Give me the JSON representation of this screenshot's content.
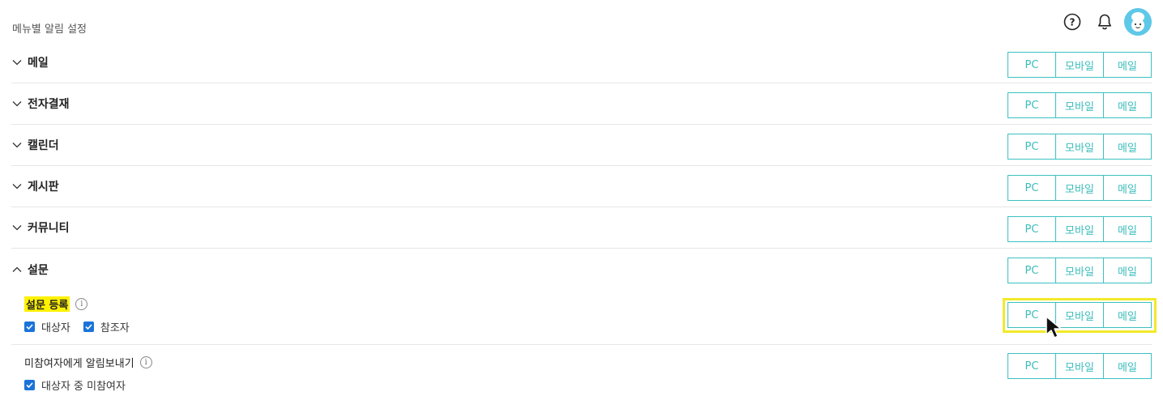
{
  "header": {
    "title": "메뉴별 알림 설정",
    "help_icon": "question-circle-icon",
    "bell_icon": "bell-icon",
    "avatar_icon": "avatar-icon"
  },
  "toggle_labels": {
    "pc": "PC",
    "mobile": "모바일",
    "mail": "메일"
  },
  "sections": [
    {
      "label": "메일",
      "expanded": false
    },
    {
      "label": "전자결재",
      "expanded": false
    },
    {
      "label": "캘린더",
      "expanded": false
    },
    {
      "label": "게시판",
      "expanded": false
    },
    {
      "label": "커뮤니티",
      "expanded": false
    },
    {
      "label": "설문",
      "expanded": true
    }
  ],
  "survey_items": [
    {
      "title": "설문 등록",
      "highlighted": true,
      "checks": [
        {
          "label": "대상자",
          "checked": true
        },
        {
          "label": "참조자",
          "checked": true
        }
      ]
    },
    {
      "title": "미참여자에게 알림보내기",
      "highlighted": false,
      "checks": [
        {
          "label": "대상자 중 미참여자",
          "checked": true
        }
      ]
    }
  ],
  "colors": {
    "accent": "#3cc0c0",
    "highlight": "#fff200",
    "checkbox": "#1a73d9"
  }
}
